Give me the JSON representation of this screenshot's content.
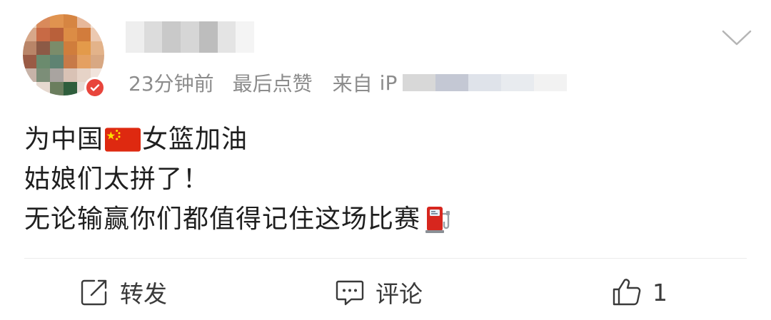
{
  "post": {
    "meta": {
      "time": "23分钟前",
      "last_like": "最后点赞",
      "source_prefix": "来自",
      "source_partial": "iP"
    },
    "content_lines": [
      {
        "before_emoji": "为中国",
        "emoji": "flag-cn-icon",
        "after_emoji": "女篮加油"
      },
      {
        "text": "姑娘们太拼了！"
      },
      {
        "text": "无论输赢你们都值得记住这场比赛",
        "emoji": "fuel-pump-icon"
      }
    ]
  },
  "actions": {
    "repost_label": "转发",
    "comment_label": "评论",
    "like_count": "1"
  },
  "colors": {
    "meta_text": "#8c8c8c",
    "body_text": "#1f1f1f",
    "action_text": "#3a3a3a",
    "divider": "#ececec",
    "badge_red": "#e8453c"
  }
}
